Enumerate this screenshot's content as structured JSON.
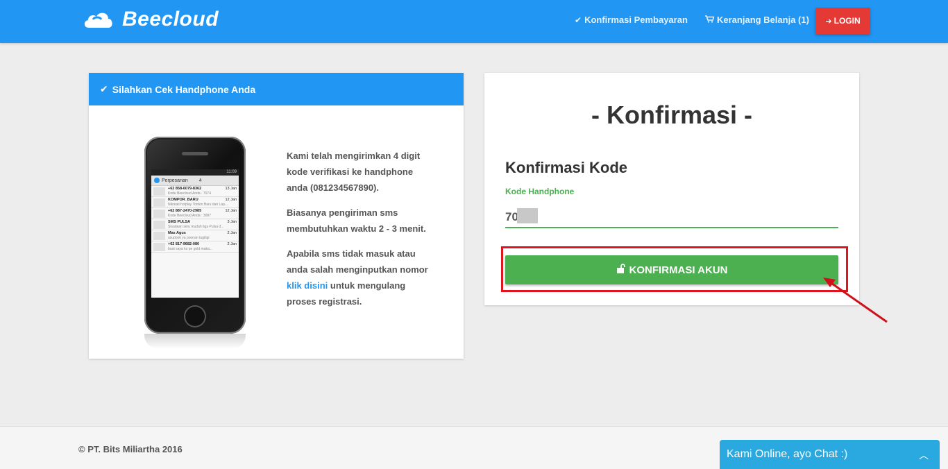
{
  "navbar": {
    "brand": "Beecloud",
    "links": [
      {
        "icon": "check-icon",
        "label": "Konfirmasi Pembayaran"
      },
      {
        "icon": "cart-icon",
        "label": "Keranjang Belanja (1)"
      }
    ],
    "login_label": "LOGIN"
  },
  "left_card": {
    "header": "Silahkan Cek Handphone Anda",
    "paragraph1": "Kami telah mengirimkan 4 digit kode verifikasi ke handphone anda (081234567890).",
    "paragraph2": "Biasanya pengiriman sms membutuhkan waktu 2 - 3 menit.",
    "paragraph3_before": "Apabila sms tidak masuk atau anda salah menginputkan nomor",
    "paragraph3_link": "klik disini",
    "paragraph3_after": "untuk mengulang proses registrasi.",
    "phone": {
      "time": "11:09",
      "app_title": "Perpesanan",
      "count": "4",
      "messages": [
        {
          "from": "+62 858-6079-8362",
          "text": "Kode Beecloud Anda : 7074",
          "date": "13 Jan"
        },
        {
          "from": "KOMPOR_BARU",
          "text": "Nikmati hotplay Tonton Baru dan Lap...",
          "date": "12 Jan"
        },
        {
          "from": "+62 887-2470-2985",
          "text": "Kode Beecloud Anda : 3087",
          "date": "12 Jan"
        },
        {
          "from": "SMS PULSA",
          "text": "Sisadaan seru mudah tiga Pulsa d...",
          "date": "3 Jan"
        },
        {
          "from": "Mas Agus",
          "text": "asupbok ya poonan tugitigi",
          "date": "2 Jan"
        },
        {
          "from": "+62 817-9682-080",
          "text": "buat saya ko pe gold maka...",
          "date": "2 Jan"
        }
      ]
    }
  },
  "right_card": {
    "title": "- Konfirmasi -",
    "subtitle": "Konfirmasi Kode",
    "field_label": "Kode Handphone",
    "field_value": "70",
    "button_label": "KONFIRMASI AKUN"
  },
  "footer": {
    "copyright": "© PT. Bits Miliartha 2016"
  },
  "chat": {
    "label": "Kami Online, ayo Chat :)"
  },
  "colors": {
    "primary": "#2196f3",
    "success": "#4caf50",
    "danger": "#e53935",
    "chat": "#29a9e0"
  }
}
